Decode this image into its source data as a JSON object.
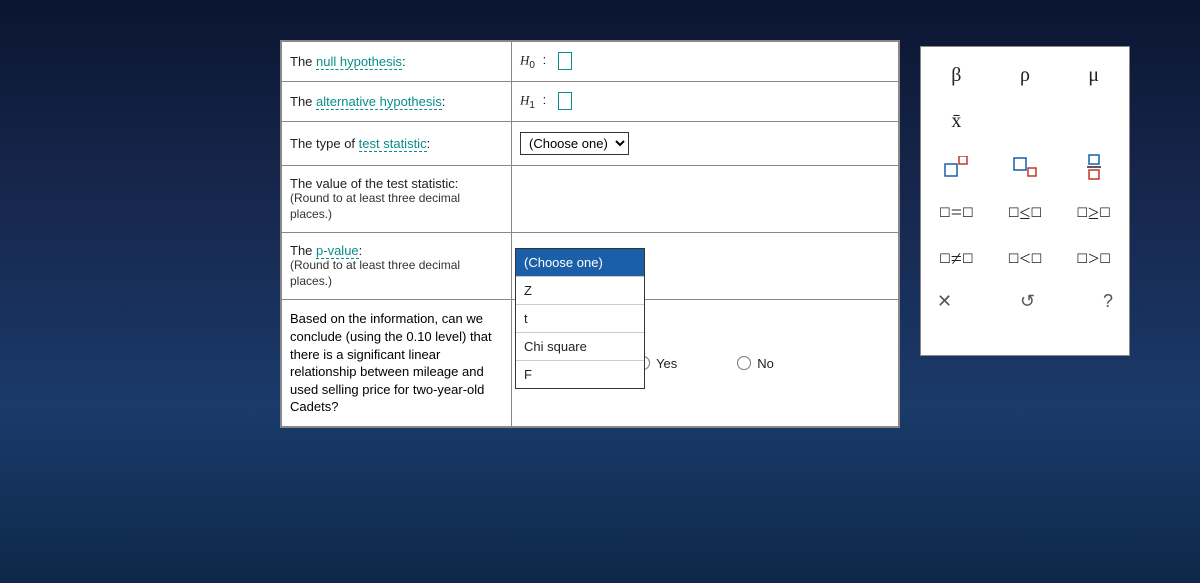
{
  "rows": {
    "null": {
      "prefix": "The ",
      "link": "null hypothesis",
      "suffix": ":",
      "sym": "H",
      "sub": "0"
    },
    "alt": {
      "prefix": "The ",
      "link": "alternative hypothesis",
      "suffix": ":",
      "sym": "H",
      "sub": "1"
    },
    "teststat": {
      "prefix": "The type of ",
      "link": "test statistic",
      "suffix": ":",
      "select_label": "(Choose one)"
    },
    "value": {
      "line1": "The value of the test statistic:",
      "note": "(Round to at least three decimal places.)"
    },
    "pvalue": {
      "prefix": "The ",
      "link": "p-value",
      "suffix": ":",
      "note": "(Round to at least three decimal places.)"
    },
    "conclusion": {
      "text": "Based on the information, can we conclude (using the 0.10 level) that there is a significant linear relationship between mileage and used selling price for two-year-old Cadets?",
      "yes": "Yes",
      "no": "No"
    }
  },
  "dropdown": {
    "opt_choose": "(Choose one)",
    "opt_z": "Z",
    "opt_t": "t",
    "opt_chi": "Chi square",
    "opt_f": "F"
  },
  "symbols": {
    "beta": "β",
    "rho": "ρ",
    "mu": "μ",
    "xbar": "x̄",
    "eq": "=",
    "le": "≤",
    "ge": "≥",
    "ne": "≠",
    "lt": "<",
    "gt": ">",
    "clear": "✕",
    "reset": "↺",
    "help": "?"
  }
}
